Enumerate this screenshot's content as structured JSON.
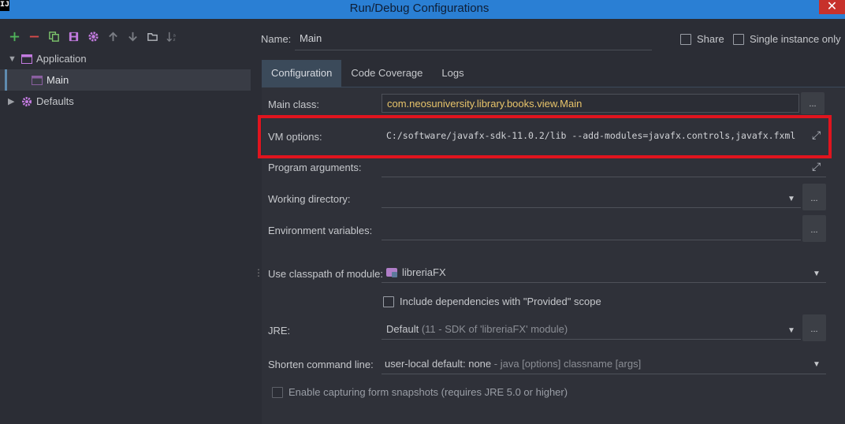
{
  "window": {
    "title": "Run/Debug Configurations",
    "app_icon": "IJ",
    "close_glyph": "✕"
  },
  "toolbar": {
    "icons": [
      "add-icon",
      "remove-icon",
      "copy-icon",
      "save-icon",
      "gear-icon",
      "arrow-up-icon",
      "arrow-down-icon",
      "folder-icon",
      "sort-icon"
    ]
  },
  "tree": {
    "application": {
      "label": "Application",
      "expanded": true
    },
    "main": {
      "label": "Main",
      "selected": true
    },
    "defaults": {
      "label": "Defaults",
      "expanded": false
    }
  },
  "header": {
    "name_label": "Name:",
    "name_value": "Main",
    "share_label": "Share",
    "share_checked": false,
    "single_instance_label": "Single instance only",
    "single_instance_checked": false
  },
  "tabs": [
    {
      "label": "Configuration",
      "active": true
    },
    {
      "label": "Code Coverage",
      "active": false
    },
    {
      "label": "Logs",
      "active": false
    }
  ],
  "config": {
    "main_class_label": "Main class:",
    "main_class_value": "com.neosuniversity.library.books.view.Main",
    "vm_options_label": "VM options:",
    "vm_options_value": "C:/software/javafx-sdk-11.0.2/lib --add-modules=javafx.controls,javafx.fxml",
    "program_args_label": "Program arguments:",
    "program_args_value": "",
    "working_dir_label": "Working directory:",
    "working_dir_value": "",
    "env_vars_label": "Environment variables:",
    "env_vars_value": "",
    "classpath_label": "Use classpath of module:",
    "classpath_value": "libreriaFX",
    "include_deps_label": "Include dependencies with \"Provided\" scope",
    "include_deps_checked": false,
    "jre_label": "JRE:",
    "jre_value": "Default",
    "jre_detail": "(11 - SDK of 'libreriaFX' module)",
    "shorten_label": "Shorten command line:",
    "shorten_value": "user-local default: none",
    "shorten_detail": "- java [options] classname [args]",
    "capture_label": "Enable capturing form snapshots (requires JRE 5.0 or higher)",
    "capture_checked": false,
    "browse_label": "...",
    "expand_glyph": "⤢",
    "dropdown_glyph": "▼"
  },
  "colors": {
    "titlebar": "#2a7fd4",
    "highlight_box": "#e0141e",
    "main_class_text": "#e8c46a",
    "active_tab": "#3b4a5a",
    "background": "#2b2d35"
  }
}
